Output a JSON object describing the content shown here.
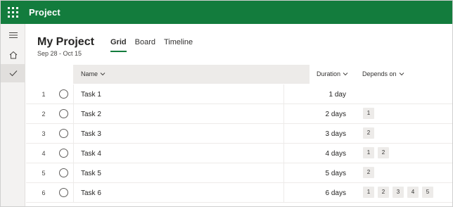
{
  "app": {
    "title": "Project"
  },
  "rail": {
    "items": [
      {
        "name": "menu-icon"
      },
      {
        "name": "home-icon"
      },
      {
        "name": "checkmark-icon"
      }
    ]
  },
  "project": {
    "title": "My Project",
    "dates": "Sep 28 - Oct 15",
    "tabs": [
      {
        "label": "Grid",
        "active": true
      },
      {
        "label": "Board",
        "active": false
      },
      {
        "label": "Timeline",
        "active": false
      }
    ]
  },
  "grid": {
    "columns": {
      "name": "Name",
      "duration": "Duration",
      "depends": "Depends on"
    },
    "rows": [
      {
        "num": "1",
        "task": "Task 1",
        "duration": "1 day",
        "depends": []
      },
      {
        "num": "2",
        "task": "Task 2",
        "duration": "2 days",
        "depends": [
          "1"
        ]
      },
      {
        "num": "3",
        "task": "Task 3",
        "duration": "3 days",
        "depends": [
          "2"
        ]
      },
      {
        "num": "4",
        "task": "Task 4",
        "duration": "4 days",
        "depends": [
          "1",
          "2"
        ]
      },
      {
        "num": "5",
        "task": "Task 5",
        "duration": "5 days",
        "depends": [
          "2"
        ]
      },
      {
        "num": "6",
        "task": "Task 6",
        "duration": "6 days",
        "depends": [
          "1",
          "2",
          "3",
          "4",
          "5"
        ]
      }
    ]
  },
  "colors": {
    "brand": "#137c3d",
    "header_bg": "#edebe9",
    "rail_bg": "#f3f2f1"
  }
}
